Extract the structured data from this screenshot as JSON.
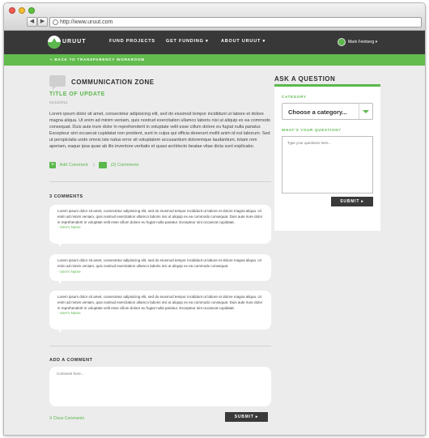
{
  "browser": {
    "url": "http://www.uruut.com",
    "back_glyph": "◀",
    "forward_glyph": "▶"
  },
  "header": {
    "logo_text": "URUUT",
    "nav": [
      "FUND PROJECTS",
      "GET FUNDING ▾",
      "ABOUT URUUT ▾"
    ],
    "user_name": "Mark Feinberg ▾"
  },
  "subnav": {
    "back_link": "« BACK TO TRANSPARENCY WORKROOM"
  },
  "main": {
    "section_title": "COMMUNICATION ZONE",
    "update_title": "TITLE OF UPDATE",
    "update_date": "01/13/2012",
    "update_body": "Lorem ipsum dolor sit amet, consectetur adipisicing elit, sed do eiusmod tempor incididunt ut labore et dolore magna aliqua. Ut enim ad minim veniam, quis nostrud exercitation ullamco laboris nisi ut aliquip ex ea commodo consequat. Duis aute irure dolor in reprehenderit in voluptate velit esse cillum dolore eu fugiat nulla pariatur. Excepteur sint occaecat cupidatat non proident, sunt in culpa qui officia deserunt mollit anim id est laborum. Sed ut perspiciatis unde omnis iste natus error sit voluptatem accusantium doloremque laudantium, totam rem aperiam, eaque ipsa quae ab illo inventore veritatis et quasi architecto beatae vitae dicta sunt explicabo.",
    "add_comment_label": "Add Comment",
    "separator": "|",
    "comments_count_label": "(3) Comments",
    "comments_heading": "3 COMMENTS",
    "comments": [
      {
        "text": "Lorem ipsum dolor sit amet, consectetur adipisicing elit, sed do eiusmod tempor incididunt ut labore et dolore magna aliqua. Ut enim ad minim veniam, quis nostrud exercitation ullamco laboris nisi ut aliquip ex ea commodo consequat. Duis aute irure dolor in reprehenderit in voluptate velit esse cillum dolore eu fugiat nulla pariatur. Excepteur sint occaecat cupidatat.",
        "author": "- User's Name"
      },
      {
        "text": "Lorem ipsum dolor sit amet, consectetur adipisicing elit, sed do eiusmod tempor incididunt ut labore et dolore magna aliqua. Ut enim ad minim veniam, quis nostrud exercitation ullamco laboris nisi ut aliquip ex ea commodo consequat.",
        "author": "- User's Name"
      },
      {
        "text": "Lorem ipsum dolor sit amet, consectetur adipisicing elit, sed do eiusmod tempor incididunt ut labore et dolore magna aliqua. Ut enim ad minim veniam, quis nostrud exercitation ullamco laboris nisi ut aliquip ex ea commodo consequat. Duis aute irure dolor in reprehenderit in voluptate velit esse cillum dolore eu fugiat nulla pariatur. Excepteur sint occaecat cupidatat.",
        "author": "- User's Name"
      }
    ],
    "add_comment_heading": "ADD A COMMENT",
    "comment_placeholder": "Comment here...",
    "close_comments": "X Close Comments",
    "submit_label": "SUBMIT ▸"
  },
  "sidebar": {
    "title": "ASK A QUESTION",
    "category_label": "CATEGORY",
    "category_value": "Choose a category...",
    "question_label": "WHAT'S YOUR QUESTION?",
    "question_placeholder": "Type your questions here...",
    "submit_label": "SUBMIT ▸"
  },
  "colors": {
    "accent_green": "#5cb84d",
    "header_dark": "#383838",
    "button_dark": "#3a3a3a"
  },
  "icons": [
    "search-globe-icon",
    "logo-icon",
    "speech-bubble-icon",
    "plus-icon",
    "chat-icon",
    "chevron-down-icon"
  ]
}
